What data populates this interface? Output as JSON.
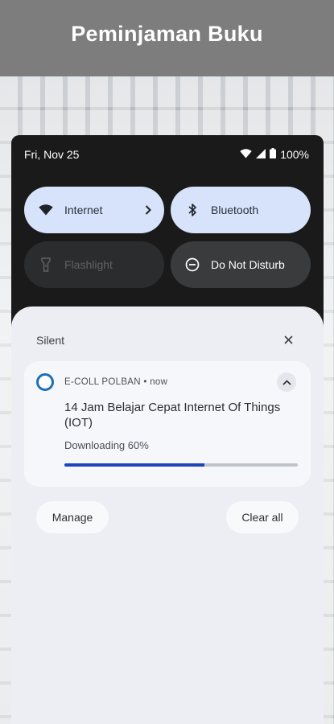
{
  "banner": {
    "title": "Peminjaman Buku"
  },
  "status_bar": {
    "date": "Fri, Nov 25",
    "battery": "100%",
    "icons": [
      "wifi-icon",
      "signal-icon",
      "battery-icon"
    ]
  },
  "quick_tiles": [
    {
      "label": "Internet",
      "icon": "wifi-icon",
      "state": "on"
    },
    {
      "label": "Bluetooth",
      "icon": "bluetooth-icon",
      "state": "on"
    },
    {
      "label": "Flashlight",
      "icon": "flashlight-icon",
      "state": "off"
    },
    {
      "label": "Do Not Disturb",
      "icon": "dnd-icon",
      "state": "off"
    }
  ],
  "notifications": {
    "section_label": "Silent",
    "item": {
      "app_name": "E-COLL POLBAN",
      "separator": "•",
      "time": "now",
      "title": "14 Jam Belajar Cepat Internet Of Things (IOT)",
      "text": "Downloading 60%",
      "progress": 0.6
    },
    "manage_label": "Manage",
    "clear_label": "Clear all"
  },
  "colors": {
    "banner": "#7d7d7d",
    "tile_on": "#d7e3fb",
    "progress": "#1b46b8",
    "app_icon": "#1f6fb8"
  }
}
